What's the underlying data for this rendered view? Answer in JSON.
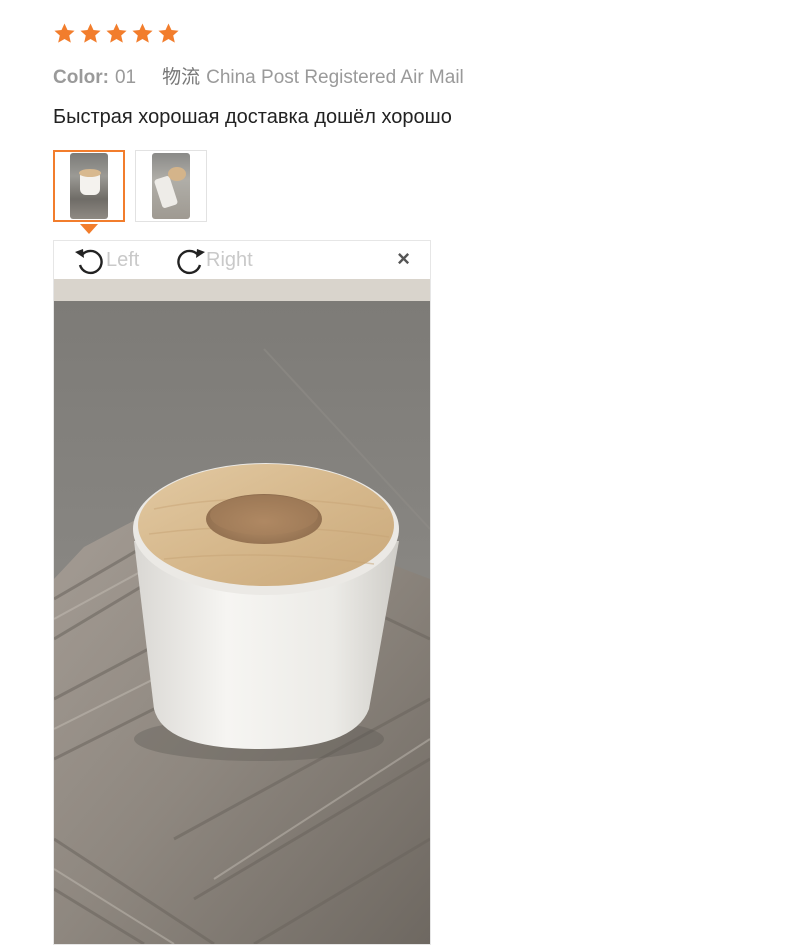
{
  "rating": {
    "stars": 5,
    "max": 5,
    "color": "#f27d2c"
  },
  "meta": {
    "color_label": "Color:",
    "color_value": "01",
    "logistics_label": "物流",
    "logistics_value": "China Post Registered Air Mail"
  },
  "review": {
    "text": "Быстрая хорошая доставка дошёл хорошо"
  },
  "thumbnails": [
    {
      "selected": true
    },
    {
      "selected": false
    }
  ],
  "viewer": {
    "rotate_left_label": "Left",
    "rotate_right_label": "Right",
    "close_icon": "×"
  },
  "colors": {
    "accent": "#f27d2c",
    "muted": "#9a9a9a"
  }
}
